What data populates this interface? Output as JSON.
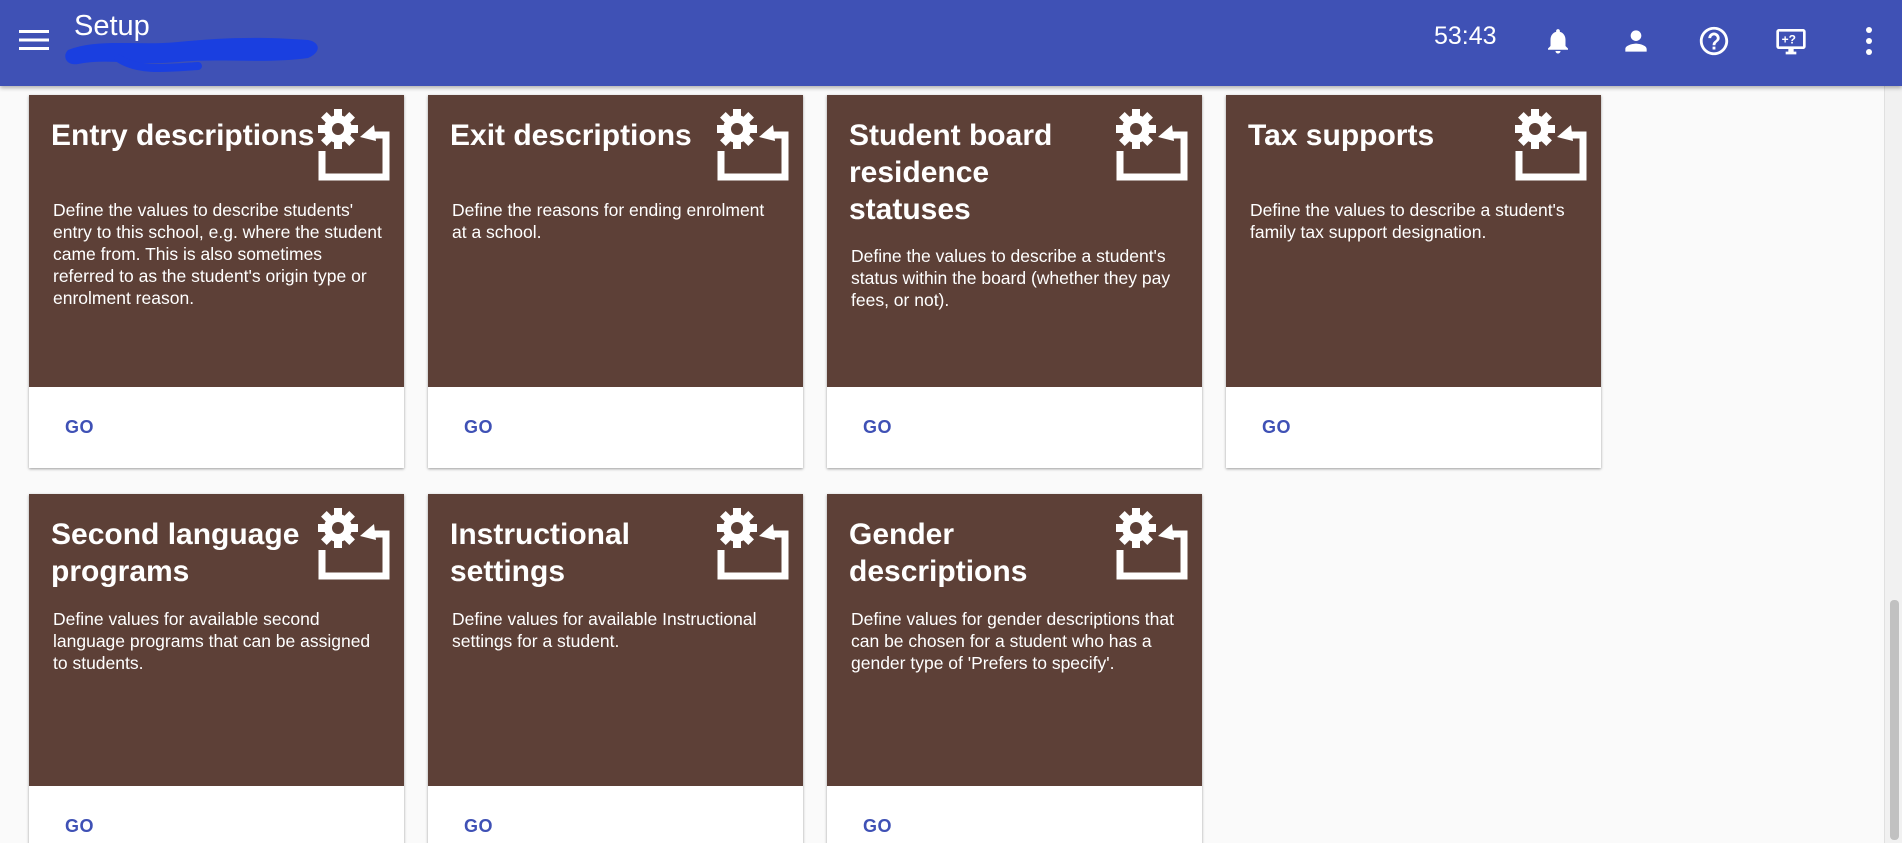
{
  "appbar": {
    "title": "Setup",
    "timer": "53:43",
    "background": "#3f51b5",
    "icons": [
      "menu-icon",
      "bell-icon",
      "person-icon",
      "help-icon",
      "remote-support-icon",
      "more-vert-icon"
    ]
  },
  "cards": [
    {
      "title": "Entry descriptions",
      "description": "Define the values to describe students' entry to this school, e.g. where the student came from. This is also sometimes referred to as the student's origin type or enrolment reason.",
      "action": "GO",
      "icon": "gear-settings-icon"
    },
    {
      "title": "Exit descriptions",
      "description": "Define the reasons for ending enrolment at a school.",
      "action": "GO",
      "icon": "gear-settings-icon"
    },
    {
      "title": "Student board residence statuses",
      "description": "Define the values to describe a student's status within the board (whether they pay fees, or not).",
      "action": "GO",
      "icon": "gear-settings-icon"
    },
    {
      "title": "Tax supports",
      "description": "Define the values to describe a student's family tax support designation.",
      "action": "GO",
      "icon": "gear-settings-icon"
    },
    {
      "title": "Second language programs",
      "description": "Define values for available second language programs that can be assigned to students.",
      "action": "GO",
      "icon": "gear-settings-icon"
    },
    {
      "title": "Instructional settings",
      "description": "Define values for available Instructional settings for a student.",
      "action": "GO",
      "icon": "gear-settings-icon"
    },
    {
      "title": "Gender descriptions",
      "description": "Define values for gender descriptions that can be chosen for a student who has a gender type of 'Prefers to specify'.",
      "action": "GO",
      "icon": "gear-settings-icon"
    }
  ],
  "colors": {
    "card_header": "#5d4037",
    "accent": "#3f51b5"
  }
}
